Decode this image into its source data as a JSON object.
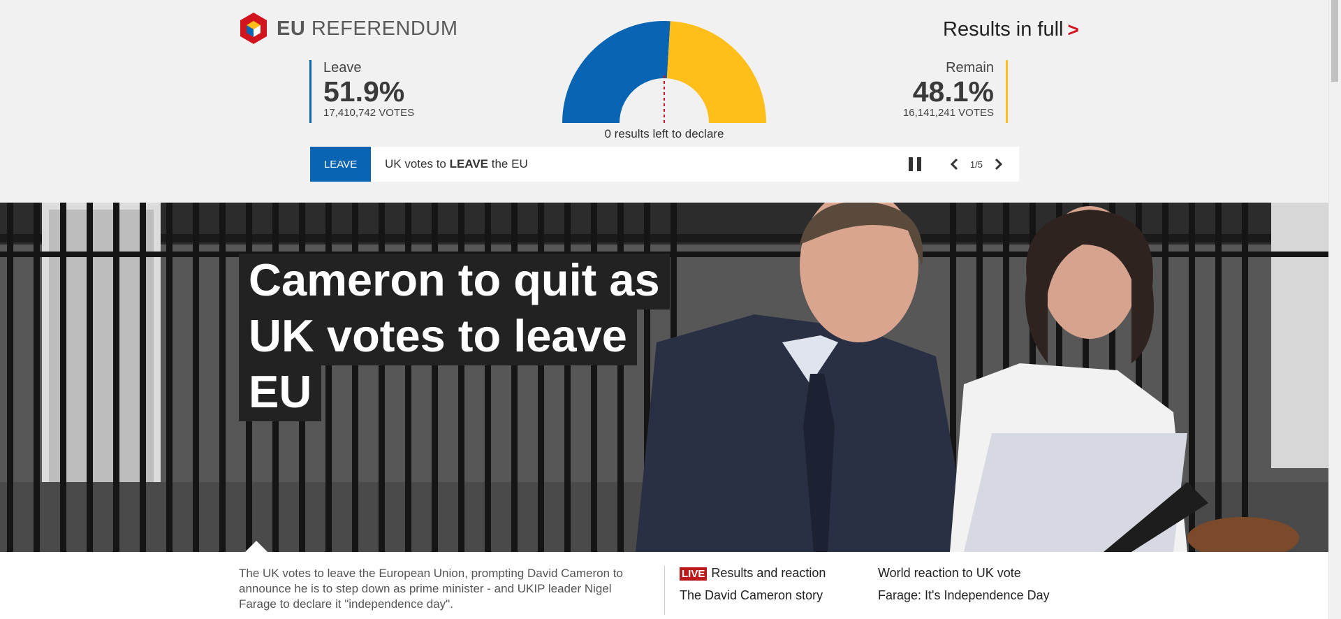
{
  "header": {
    "logo_bold": "EU",
    "logo_rest": "REFERENDUM",
    "results_link": "Results in full",
    "results_chevron": ">"
  },
  "results": {
    "leave": {
      "label": "Leave",
      "percent": "51.9%",
      "votes": "17,410,742 VOTES",
      "share": 51.9,
      "color": "#0a64b4"
    },
    "remain": {
      "label": "Remain",
      "percent": "48.1%",
      "votes": "16,141,241 VOTES",
      "share": 48.1,
      "color": "#ffbe19"
    },
    "declare_text": "0 results left to declare"
  },
  "ticker": {
    "badge": "LEAVE",
    "text_before": "UK votes to ",
    "text_bold": "LEAVE",
    "text_after": " the EU",
    "counter": "1/5",
    "icons": [
      "pause-icon",
      "chevron-left-icon",
      "chevron-right-icon"
    ]
  },
  "hero": {
    "headline_lines": [
      "Cameron to quit as",
      "UK votes to leave",
      "EU"
    ]
  },
  "story": {
    "summary": "The UK votes to leave the European Union, prompting David Cameron to announce he is to step down as prime minister - and UKIP leader Nigel Farage to declare it \"independence day\".",
    "live_badge": "LIVE",
    "links": [
      "Results and reaction",
      "The David Cameron story",
      "World reaction to UK vote",
      "Farage: It's Independence Day"
    ]
  }
}
